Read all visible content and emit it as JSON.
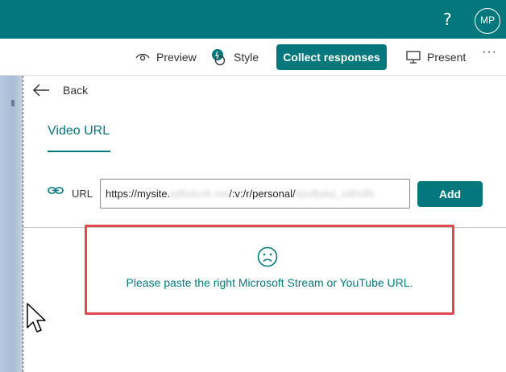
{
  "topbar": {
    "help_label": "?",
    "avatar_initials": "MP",
    "color": "#03787c"
  },
  "toolbar": {
    "preview_label": "Preview",
    "style_label": "Style",
    "collect_label": "Collect responses",
    "present_label": "Present",
    "more_label": "···"
  },
  "panel": {
    "back_label": "Back",
    "tab_label": "Video URL",
    "url_label": "URL",
    "url_value_visible_start": "https://mysite.",
    "url_value_obscured_1": "sdfsdcvb.net",
    "url_value_visible_mid": "/:v:/r/personal/",
    "url_value_obscured_2": "kjsdfjskd_sdfsdfs",
    "add_label": "Add",
    "error_message": "Please paste the right Microsoft Stream or YouTube URL.",
    "error_border_color": "#e2484f"
  }
}
